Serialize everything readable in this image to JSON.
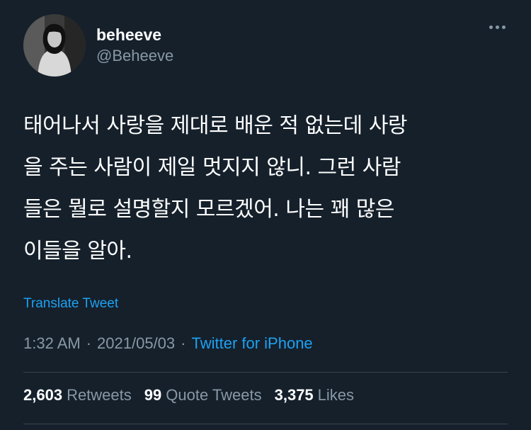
{
  "user": {
    "display_name": "beheeve",
    "handle": "@Beheeve"
  },
  "tweet": {
    "lines": [
      "태어나서 사랑을 제대로 배운 적 없는데 사랑",
      "을 주는 사람이 제일 멋지지 않니. 그런 사람",
      "들은 뭘로 설명할지 모르겠어. 나는 꽤 많은",
      "이들을 알아."
    ],
    "translate_label": "Translate Tweet",
    "time": "1:32 AM",
    "date": "2021/05/03",
    "separator": "·",
    "source": "Twitter for iPhone"
  },
  "stats": {
    "retweets_count": "2,603",
    "retweets_label": "Retweets",
    "quote_count": "99",
    "quote_label": "Quote Tweets",
    "likes_count": "3,375",
    "likes_label": "Likes"
  },
  "colors": {
    "background": "#15202b",
    "text_primary": "#ffffff",
    "text_secondary": "#8899a6",
    "accent": "#1da1f2",
    "divider": "#38444d"
  },
  "icons": {
    "more": "more-horizontal-icon",
    "avatar": "profile-photo"
  }
}
